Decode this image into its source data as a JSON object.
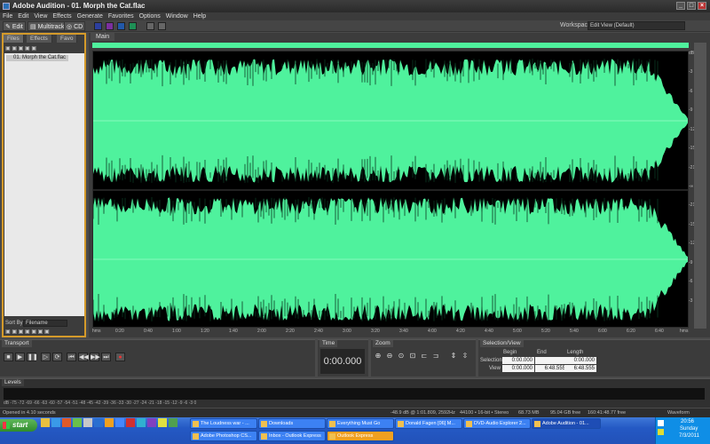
{
  "window": {
    "title": "Adobe Audition - 01. Morph the Cat.flac"
  },
  "menu": [
    "File",
    "Edit",
    "View",
    "Effects",
    "Generate",
    "Favorites",
    "Options",
    "Window",
    "Help"
  ],
  "toolbar": {
    "edit_label": "Edit",
    "multitrack_label": "Multitrack",
    "cd_label": "CD",
    "workspace_label": "Workspace:",
    "workspace_value": "Edit View (Default)"
  },
  "files_panel": {
    "tabs": [
      "Files",
      "Effects",
      "Favo"
    ],
    "items": [
      "01. Morph the Cat.flac"
    ],
    "sort_label": "Sort By:",
    "sort_value": "Filename"
  },
  "main": {
    "tab": "Main",
    "time_ticks": [
      "hms",
      "0:20",
      "0:40",
      "1:00",
      "1:20",
      "1:40",
      "2:00",
      "2:20",
      "2:40",
      "3:00",
      "3:20",
      "3:40",
      "4:00",
      "4:20",
      "4:40",
      "5:00",
      "5:20",
      "5:40",
      "6:00",
      "6:20",
      "6:40",
      "hms"
    ],
    "db_ticks": [
      "dB",
      "-3",
      "-6",
      "-9",
      "-12",
      "-15",
      "-21",
      "-∞",
      "-21",
      "-15",
      "-12",
      "-9",
      "-6",
      "-3"
    ],
    "waveform_color": "#4ff29d"
  },
  "transport": {
    "title": "Transport"
  },
  "time": {
    "title": "Time",
    "value": "0:00.000"
  },
  "zoom": {
    "title": "Zoom"
  },
  "selection": {
    "title": "Selection/View",
    "col_begin": "Begin",
    "col_end": "End",
    "col_length": "Length",
    "row_selection": "Selection",
    "row_view": "View",
    "sel_begin": "0:00.000",
    "sel_end": "",
    "sel_length": "0:00.000",
    "view_begin": "0:00.000",
    "view_end": "6:48.555",
    "view_length": "6:48.555"
  },
  "levels": {
    "title": "Levels",
    "scale": "dB -75 -72 -69 -66 -63 -60 -57 -54 -51 -48 -45 -42 -39 -36 -33 -30 -27 -24 -21 -18 -15 -12 -9 -6 -3 0"
  },
  "status": {
    "left": "Opened in 4.10 seconds",
    "db": "-48.9 dB @ 1:01.809, 2592Hz",
    "format": "44100 • 16-bit • Stereo",
    "size": "68.73 MB",
    "free": "95.04 GB free",
    "duration": "160:41:48.77 free",
    "view": "Waveform"
  },
  "taskbar": {
    "start": "start",
    "row1": [
      "The Loudness war - ...",
      "Downloads",
      "Everything Must Go",
      "Donald Fagen [06] M...",
      "DVD-Audio Explorer 2...",
      "Adobe Audition - 01..."
    ],
    "row2": [
      "Adobe Photoshop CS...",
      "Inbox - Outlook Express",
      "Outlook Express"
    ],
    "clock_time": "20:56",
    "clock_day": "Sunday",
    "clock_date": "7/3/2011"
  }
}
